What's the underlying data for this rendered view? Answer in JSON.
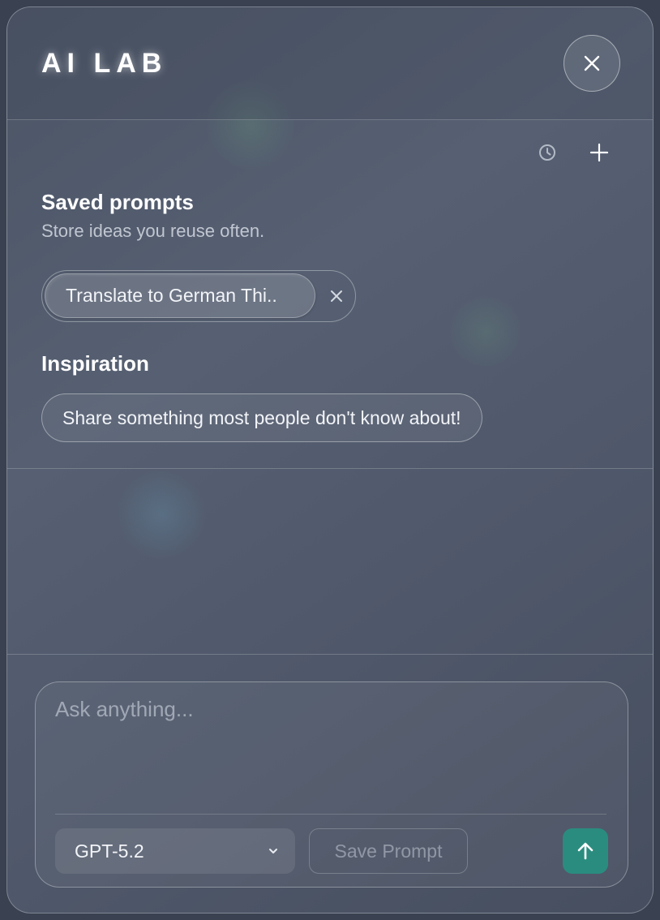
{
  "header": {
    "title": "AI LAB",
    "close_icon": "close-icon"
  },
  "prompts": {
    "history_icon": "clock-icon",
    "add_icon": "plus-icon",
    "saved_title": "Saved prompts",
    "saved_subtitle": "Store ideas you reuse often.",
    "saved_items": [
      {
        "label": "Translate to German Thi..",
        "remove_icon": "close-icon"
      }
    ],
    "inspiration_title": "Inspiration",
    "inspiration_items": [
      {
        "label": "Share something most people don't know about!"
      }
    ]
  },
  "composer": {
    "placeholder": "Ask anything...",
    "value": "",
    "model": "GPT-5.2",
    "model_icon": "chevron-down-icon",
    "save_label": "Save Prompt",
    "send_icon": "arrow-up-icon"
  },
  "colors": {
    "accent": "#2a8c7f",
    "text": "#ffffff",
    "muted": "#c9ced8"
  }
}
